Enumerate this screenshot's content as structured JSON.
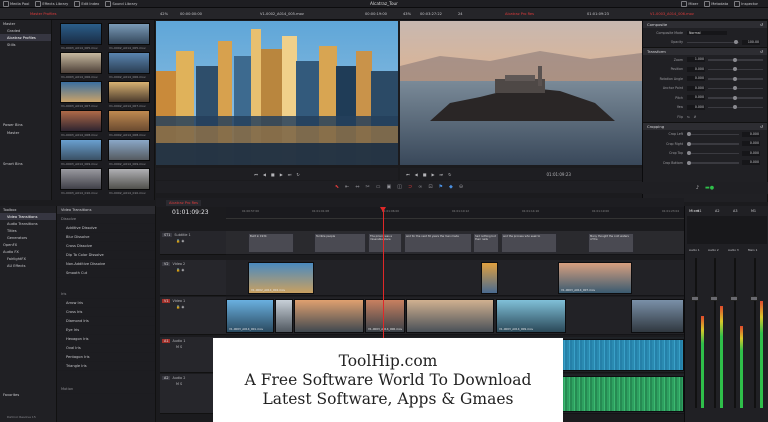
{
  "topbar": {
    "left_tabs": [
      "Media Pool",
      "Effects Library",
      "Edit Index",
      "Sound Library"
    ],
    "project_title": "Alcatraz_Tour",
    "right_tabs": [
      "Mixer",
      "Metadata",
      "Inspector"
    ]
  },
  "source_viewer": {
    "bin_label": "Master Profiles",
    "zoom": "42%",
    "timecode_in": "00:00:00:00",
    "clip_name": "V1-0002_A014_005.mov",
    "timecode": "00:00:19:00"
  },
  "program_viewer": {
    "zoom": "43%",
    "timecode_in": "00:03:27:22",
    "fps": "24",
    "bin_label": "Alcatraz Pro Res",
    "timecode": "01:01:09:23",
    "clip_name": "V1-0003_A014_006.mov"
  },
  "media_pool": {
    "bins": [
      "Master",
      "Graded",
      "Alcatraz Profiles",
      "Stills"
    ],
    "power_bins_label": "Power Bins",
    "power_bins": [
      "Master"
    ],
    "smart_bins_label": "Smart Bins",
    "thumbs": [
      "V1-0003_A014_005.mov",
      "V1-0002_A014_005.mov",
      "V1-0003_A014_006.mov",
      "V1-0002_A014_006.mov",
      "V1-0003_A014_007.mov",
      "V1-0002_A014_007.mov",
      "V1-0003_A014_008.mov",
      "V1-0002_A014_008.mov",
      "V1-0003_A014_009.mov",
      "V1-0002_A014_009.mov",
      "V1-0003_A014_010.mov",
      "V1-0002_A014_010.mov",
      "V1-0003_A014_011.mov",
      "V1-0002_A014_011.mov"
    ]
  },
  "inspector": {
    "title": "V1-0003_A014_006.mov",
    "composite_label": "Composite",
    "composite_mode_label": "Composite Mode",
    "composite_mode_value": "Normal",
    "opacity_label": "Opacity",
    "opacity_value": "100.00",
    "transform_label": "Transform",
    "transform_rows": [
      {
        "label": "Zoom",
        "value": "1.000"
      },
      {
        "label": "Position",
        "value": "0.000"
      },
      {
        "label": "Rotation Angle",
        "value": "0.000"
      },
      {
        "label": "Anchor Point",
        "value": "0.000"
      },
      {
        "label": "Pitch",
        "value": "0.000"
      },
      {
        "label": "Yaw",
        "value": "0.000"
      },
      {
        "label": "Flip",
        "value": ""
      }
    ],
    "cropping_label": "Cropping",
    "cropping_rows": [
      {
        "label": "Crop Left",
        "value": "0.000"
      },
      {
        "label": "Crop Right",
        "value": "0.000"
      },
      {
        "label": "Crop Top",
        "value": "0.000"
      },
      {
        "label": "Crop Bottom",
        "value": "0.000"
      }
    ]
  },
  "effects": {
    "toolbox_label": "Toolbox",
    "categories": [
      "Video Transitions",
      "Audio Transitions",
      "Titles",
      "Generators",
      "OpenFX",
      "Audio FX",
      "FairlightFX",
      "AU Effects"
    ],
    "header": "Video Transitions",
    "dissolve_label": "Dissolve",
    "dissolves": [
      "Additive Dissolve",
      "Blur Dissolve",
      "Cross Dissolve",
      "Dip To Color Dissolve",
      "Non-Additive Dissolve",
      "Smooth Cut"
    ],
    "iris_label": "Iris",
    "iris": [
      "Arrow Iris",
      "Cross Iris",
      "Diamond Iris",
      "Eye Iris",
      "Hexagon Iris",
      "Oval Iris",
      "Pentagon Iris",
      "Triangle Iris"
    ],
    "motion_label": "Motion",
    "favorites_label": "Favorites",
    "app_label": "DaVinci Resolve 15"
  },
  "timeline": {
    "name_tab": "Alcatraz Pro Res",
    "timecode": "01:01:09:23",
    "ruler": [
      "01:00:57:00",
      "01:01:01:08",
      "01:01:06:00",
      "01:01:10:12",
      "01:01:14:16",
      "01:01:19:00",
      "01:01:23:04",
      "01:01:27:08"
    ],
    "tracks": {
      "st1": {
        "id": "ST1",
        "name": "Subtitle 1"
      },
      "v2": {
        "id": "V2",
        "name": "Video 2"
      },
      "v1": {
        "id": "V1",
        "name": "Video 1"
      },
      "a1": {
        "id": "A1",
        "name": "Audio 1"
      },
      "a2": {
        "id": "A2",
        "name": "Audio 2"
      }
    },
    "subtitles": [
      "Built in 1934",
      "Terrible people",
      "The prison was a miserable place",
      "and for the next 30 years the men made",
      "had nothing but their nails",
      "and the process who seek to",
      "Many thought the cold waters of the"
    ],
    "clip_labels": {
      "v2_a": "V1-0002_A014_004.mov",
      "v2_c": "V1-0003_A014_007.mov",
      "v1_a": "V1-0003_A014_001.mov",
      "v1_b": "V1-0003_A014_006.mov",
      "v1_c": "V1-0003_A014_009.mov",
      "a1": "V1-0003_A014_003.mov"
    }
  },
  "mixer": {
    "title": "Mixer",
    "channels": [
      "A1",
      "A2",
      "A3",
      "M1"
    ],
    "strips": [
      "Audio 1",
      "Audio 2",
      "Audio 3",
      "Main 1"
    ]
  },
  "watermark": {
    "line1": "ToolHip.com",
    "line2": "A Free Software World To Download",
    "line3": "Latest Software, Apps & Gmaes"
  }
}
